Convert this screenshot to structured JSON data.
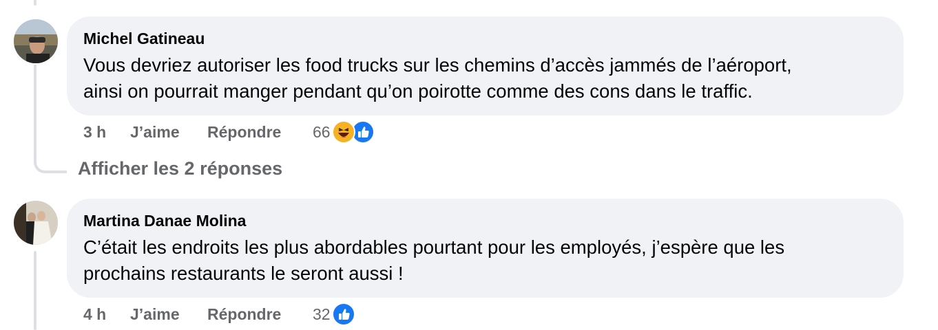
{
  "comments": [
    {
      "author": "Michel Gatineau",
      "text_line1": "Vous devriez autoriser les food trucks sur les chemins d’accès jammés de l’aéroport,",
      "text_line2": "ainsi on pourrait manger pendant qu’on poirotte comme des cons dans le traffic.",
      "time": "3 h",
      "like_label": "J’aime",
      "reply_label": "Répondre",
      "reaction_count": "66",
      "reactions": [
        "haha-icon",
        "thumbs-up-icon"
      ]
    },
    {
      "author": "Martina Danae Molina",
      "text_line1": "C’était les endroits les plus abordables pourtant pour les employés, j’espère que les",
      "text_line2": "prochains restaurants le seront aussi !",
      "time": "4 h",
      "like_label": "J’aime",
      "reply_label": "Répondre",
      "reaction_count": "32",
      "reactions": [
        "thumbs-up-icon"
      ]
    }
  ],
  "show_replies_label": "Afficher les 2 réponses",
  "colors": {
    "bubble": "#f0f2f5",
    "secondary_text": "#65676b",
    "like_blue": "#1877f2",
    "haha_yellow": "#f7b125"
  }
}
